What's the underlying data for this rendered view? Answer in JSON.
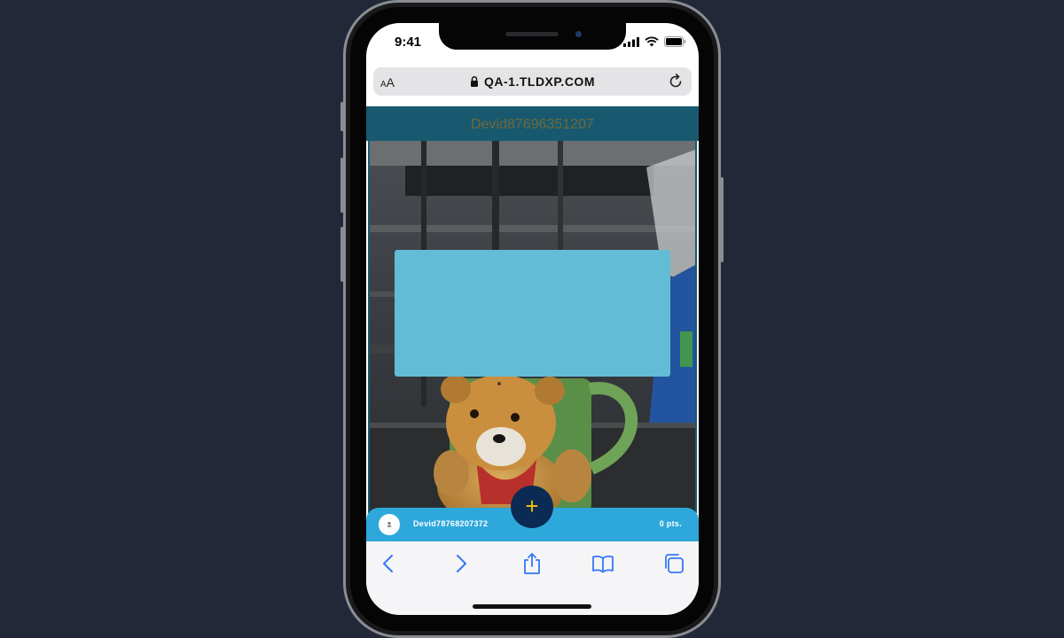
{
  "status_bar": {
    "time": "9:41",
    "icons": [
      "cellular-signal-icon",
      "wifi-icon",
      "battery-icon"
    ]
  },
  "browser": {
    "text_size_label_small": "A",
    "text_size_label_large": "A",
    "url": "QA-1.TLDXP.COM",
    "icons": [
      "lock-icon",
      "reload-icon"
    ]
  },
  "site": {
    "header_title": "Devid87696351207"
  },
  "player": {
    "name": "Devid78768207372",
    "points": "0 pts.",
    "avatar_icon": "user-icon"
  },
  "fab": {
    "label": "+"
  },
  "toolbar": {
    "items": [
      "back-icon",
      "forward-icon",
      "share-icon",
      "bookmarks-icon",
      "tabs-icon"
    ]
  },
  "colors": {
    "page_bg": "#222838",
    "header_bg": "#18596f",
    "overlay_box": "#62bcd6",
    "player_bar": "#2ea8db",
    "fab_bg": "#0b2b55",
    "fab_plus": "#f2c200",
    "ios_blue": "#3478f6"
  }
}
